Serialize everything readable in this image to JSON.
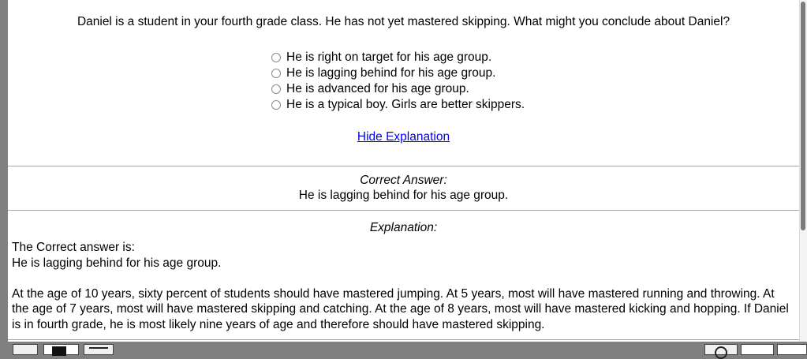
{
  "question": "Daniel is a student in your fourth grade class. He has not yet mastered skipping. What might you conclude about Daniel?",
  "options": [
    "He is right on target for his age group.",
    "He is lagging behind for his age group.",
    "He is advanced for his age group.",
    "He is a typical boy. Girls are better skippers."
  ],
  "hide_explanation_link": "Hide Explanation",
  "correct_answer": {
    "label": "Correct Answer:",
    "value": "He is lagging behind for his age group."
  },
  "explanation": {
    "label": "Explanation:",
    "intro": "The Correct answer is:",
    "answer": "He is lagging behind for his age group.",
    "body": "At the age of 10 years, sixty percent of students should have mastered jumping. At 5 years, most will have mastered running and throwing. At the age of 7 years, most will have mastered skipping and catching. At the age of 8 years, most will have mastered kicking and hopping. If Daniel is in fourth grade, he is most likely nine years of age and therefore should have mastered skipping."
  },
  "colors": {
    "link": "#0000ee",
    "frame_background": "#ffffff",
    "outer_background": "#808080",
    "rule": "#a8a8a8"
  }
}
